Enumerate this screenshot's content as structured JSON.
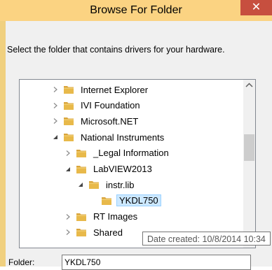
{
  "dialog": {
    "title": "Browse For Folder",
    "close_glyph": "✕",
    "instruction": "Select the folder that contains drivers for your hardware."
  },
  "tree": {
    "items": [
      {
        "label": "Internet Explorer",
        "depth": 0,
        "state": "collapsed",
        "selected": false
      },
      {
        "label": "IVI Foundation",
        "depth": 0,
        "state": "collapsed",
        "selected": false
      },
      {
        "label": "Microsoft.NET",
        "depth": 0,
        "state": "collapsed",
        "selected": false
      },
      {
        "label": "National Instruments",
        "depth": 0,
        "state": "expanded",
        "selected": false
      },
      {
        "label": "_Legal Information",
        "depth": 1,
        "state": "collapsed",
        "selected": false
      },
      {
        "label": "LabVIEW2013",
        "depth": 1,
        "state": "expanded",
        "selected": false
      },
      {
        "label": "instr.lib",
        "depth": 2,
        "state": "expanded",
        "selected": false
      },
      {
        "label": "YKDL750",
        "depth": 3,
        "state": "none",
        "selected": true
      },
      {
        "label": "RT Images",
        "depth": 1,
        "state": "collapsed",
        "selected": false
      },
      {
        "label": "Shared",
        "depth": 1,
        "state": "collapsed",
        "selected": false
      }
    ],
    "scroll_position": 0.35
  },
  "tooltip": {
    "text": "Date created: 10/8/2014 10:34"
  },
  "folder_field": {
    "label": "Folder:",
    "value": "YKDL750"
  },
  "colors": {
    "accent_frame": "#f0d07f",
    "close_button": "#c74f3f",
    "selection": "#cce8ff",
    "folder": "#e8b94a"
  }
}
